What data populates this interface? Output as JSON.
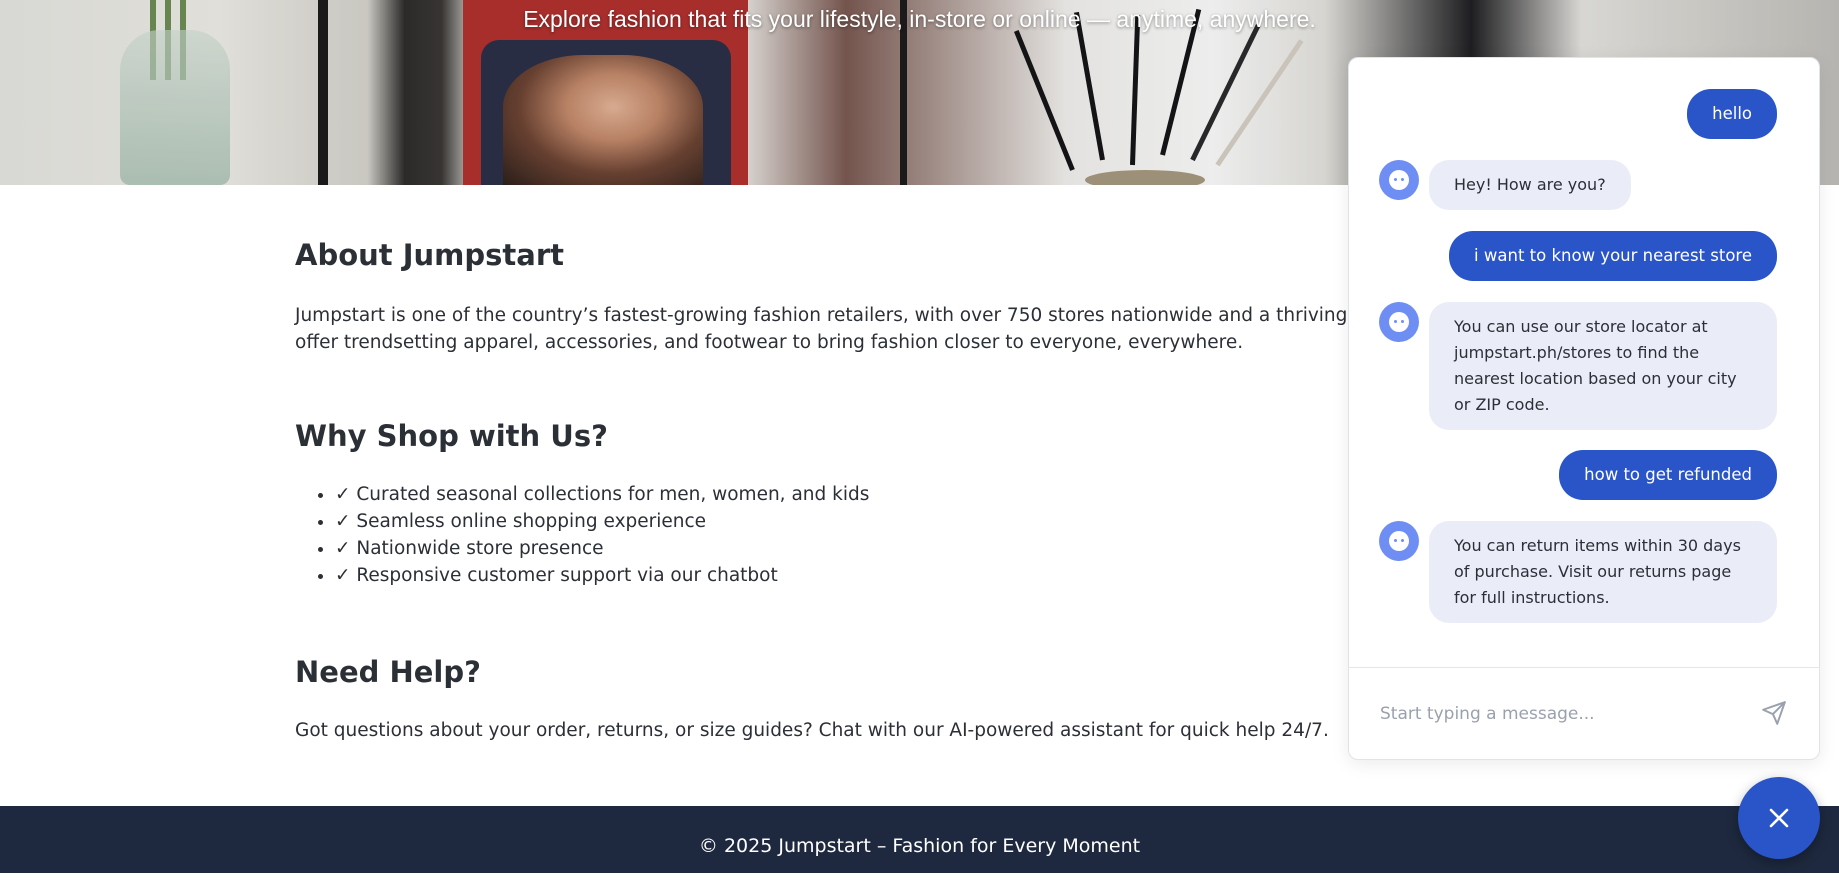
{
  "hero": {
    "tagline": "Explore fashion that fits your lifestyle, in-store or online — anytime, anywhere."
  },
  "about": {
    "heading": "About Jumpstart",
    "body_line1": "Jumpstart is one of the country’s fastest-growing fashion retailers, with over 750 stores nationwide and a thriving e-commerce platform. We",
    "body_line2": "offer trendsetting apparel, accessories, and footwear to bring fashion closer to everyone, everywhere."
  },
  "why": {
    "heading": "Why Shop with Us?",
    "items": [
      "✓ Curated seasonal collections for men, women, and kids",
      "✓ Seamless online shopping experience",
      "✓ Nationwide store presence",
      "✓ Responsive customer support via our chatbot"
    ]
  },
  "help": {
    "heading": "Need Help?",
    "body": "Got questions about your order, returns, or size guides? Chat with our AI-powered assistant for quick help 24/7."
  },
  "footer": {
    "text": "© 2025 Jumpstart – Fashion for Every Moment"
  },
  "chat": {
    "messages": [
      {
        "from": "user",
        "text": "hello"
      },
      {
        "from": "bot",
        "text": "Hey! How are you?"
      },
      {
        "from": "user",
        "text": "i want to know your nearest store"
      },
      {
        "from": "bot",
        "text": "You can use our store locator at jumpstart.ph/stores to find the nearest location based on your city or ZIP code."
      },
      {
        "from": "user",
        "text": "how to get refunded"
      },
      {
        "from": "bot",
        "text": "You can return items within 30 days of purchase. Visit our returns page for full instructions."
      }
    ],
    "input_placeholder": "Start typing a message...",
    "input_value": "",
    "send_icon": "paper-plane-icon",
    "close_icon": "close-icon",
    "bot_avatar_icon": "bot-face-icon"
  },
  "colors": {
    "accent": "#2955c9",
    "bot_bubble": "#eaedf7",
    "avatar": "#6f8ef3",
    "footer_bg": "#1e293f"
  }
}
